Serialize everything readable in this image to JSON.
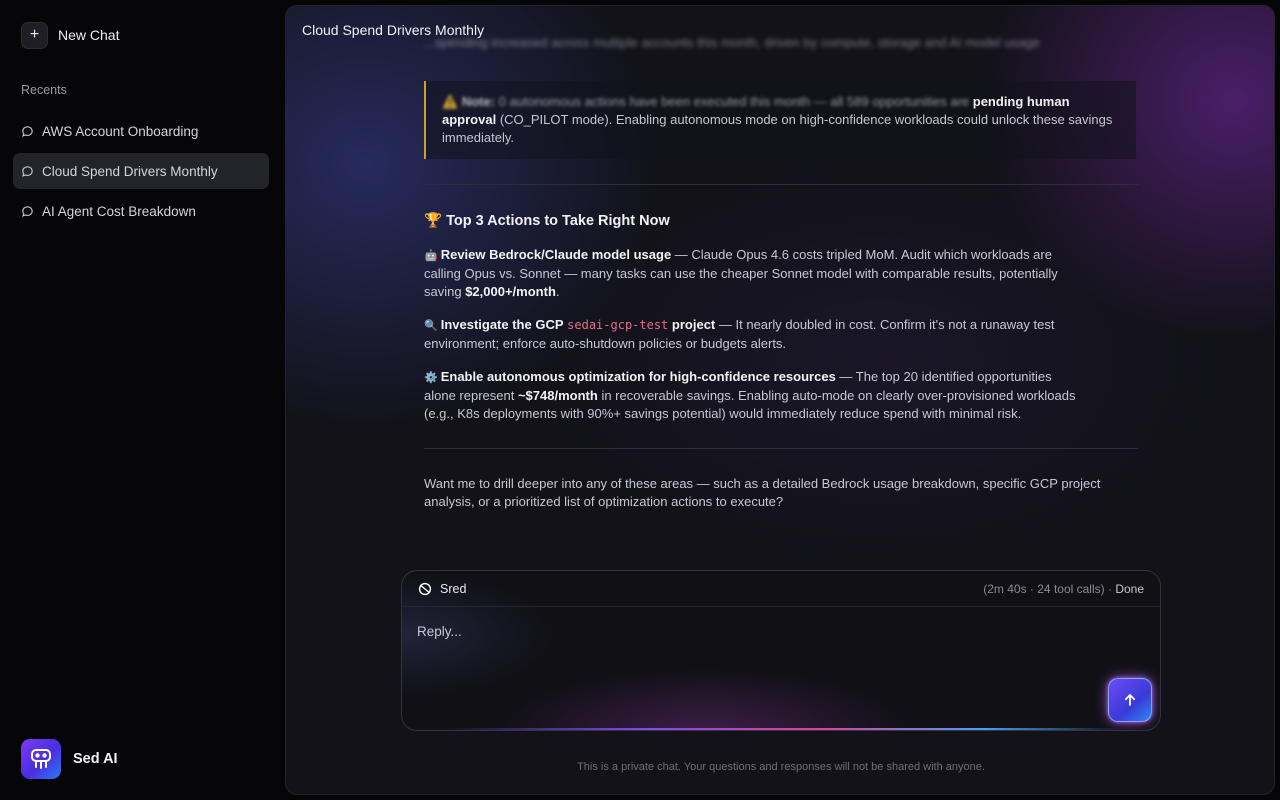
{
  "sidebar": {
    "new_chat_label": "New Chat",
    "recents_heading": "Recents",
    "items": [
      {
        "label": "AWS Account Onboarding"
      },
      {
        "label": "Cloud Spend Drivers Monthly"
      },
      {
        "label": "AI Agent Cost Breakdown"
      }
    ],
    "brand_name": "Sed AI"
  },
  "chat": {
    "title": "Cloud Spend Drivers Monthly",
    "blurred_intro": "...spending increased across multiple accounts this month, driven by compute, storage and AI model usage",
    "note": {
      "icon": "⚠️",
      "label": "Note:",
      "text1": "0 autonomous actions have been executed this month — all 589 opportunities are",
      "emph": "pending human approval",
      "text2": "(CO_PILOT mode). Enabling autonomous mode on high-confidence workloads could unlock these savings immediately."
    },
    "actions_heading": {
      "icon": "🏆",
      "text": "Top 3 Actions to Take Right Now"
    },
    "actions": [
      {
        "icon": "🤖",
        "title": "Review Bedrock/Claude model usage",
        "body": "— Claude Opus 4.6 costs tripled MoM. Audit which workloads are calling Opus vs. Sonnet — many tasks can use the cheaper Sonnet model with comparable results, potentially saving",
        "emph": "$2,000+/month",
        "tail": "."
      },
      {
        "icon": "🔍",
        "title_pre": "Investigate the GCP",
        "code": "sedai-gcp-test",
        "title_post": "project",
        "body": "— It nearly doubled in cost. Confirm it's not a runaway test environment; enforce auto-shutdown policies or budgets alerts."
      },
      {
        "icon": "⚙️",
        "title": "Enable autonomous optimization for high-confidence resources",
        "body1": "— The top 20 identified opportunities alone represent",
        "emph": "~$748/month",
        "body2": "in recoverable savings. Enabling auto-mode on clearly over-provisioned workloads (e.g., K8s deployments with 90%+ savings potential) would immediately reduce spend with minimal risk."
      }
    ],
    "closing": "Want me to drill deeper into any of these areas — such as a detailed Bedrock usage breakdown, specific GCP project analysis, or a prioritized list of optimization actions to execute?"
  },
  "composer": {
    "agent_name": "Sred",
    "status": "(2m 40s · 24 tool calls) ·",
    "status_done": "Done",
    "placeholder": "Reply..."
  },
  "footer": {
    "privacy_note": "This is a private chat. Your questions and responses will not be shared with anyone."
  }
}
